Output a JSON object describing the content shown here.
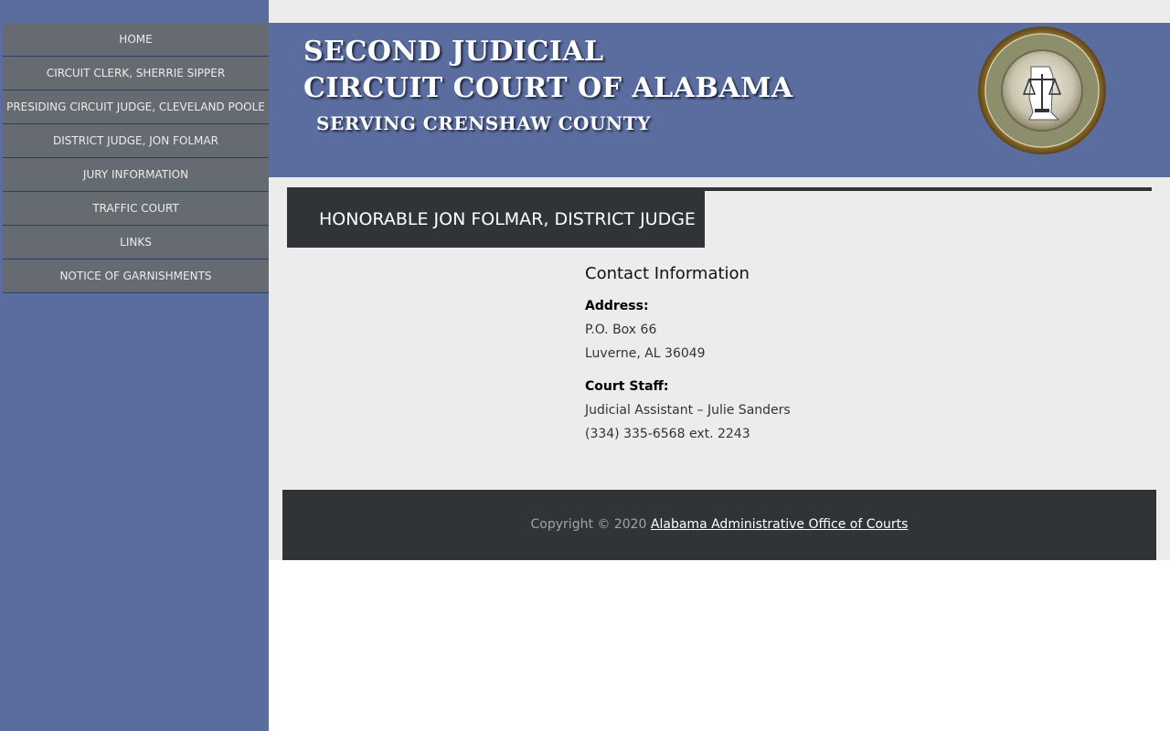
{
  "sidebar": {
    "items": [
      {
        "label": "HOME"
      },
      {
        "label": "CIRCUIT CLERK, SHERRIE SIPPER"
      },
      {
        "label": "PRESIDING CIRCUIT JUDGE, CLEVELAND POOLE"
      },
      {
        "label": "DISTRICT JUDGE, JON FOLMAR"
      },
      {
        "label": "JURY INFORMATION"
      },
      {
        "label": "TRAFFIC COURT"
      },
      {
        "label": "LINKS"
      },
      {
        "label": "NOTICE OF GARNISHMENTS"
      }
    ]
  },
  "banner": {
    "line1": "SECOND JUDICIAL",
    "line2": "CIRCUIT COURT OF ALABAMA",
    "line3": "SERVING CRENSHAW COUNTY",
    "seal_icon": "alabama-unified-judicial-system-seal"
  },
  "page": {
    "title": "HONORABLE JON FOLMAR, DISTRICT JUDGE"
  },
  "contact": {
    "heading": "Contact Information",
    "address_label": "Address:",
    "address_line1": "P.O. Box 66",
    "address_line2": "Luverne, AL 36049",
    "staff_label": "Court Staff:",
    "staff_line1": "Judicial Assistant – Julie Sanders",
    "staff_line2": "(334) 335-6568 ext. 2243"
  },
  "footer": {
    "copyright": "Copyright © 2020",
    "link_text": "Alabama Administrative Office of Courts"
  },
  "colors": {
    "sidebar_bg": "#5b6d9e",
    "nav_item_bg": "#656b70",
    "dark_bar": "#303437",
    "content_bg": "#ececec"
  }
}
